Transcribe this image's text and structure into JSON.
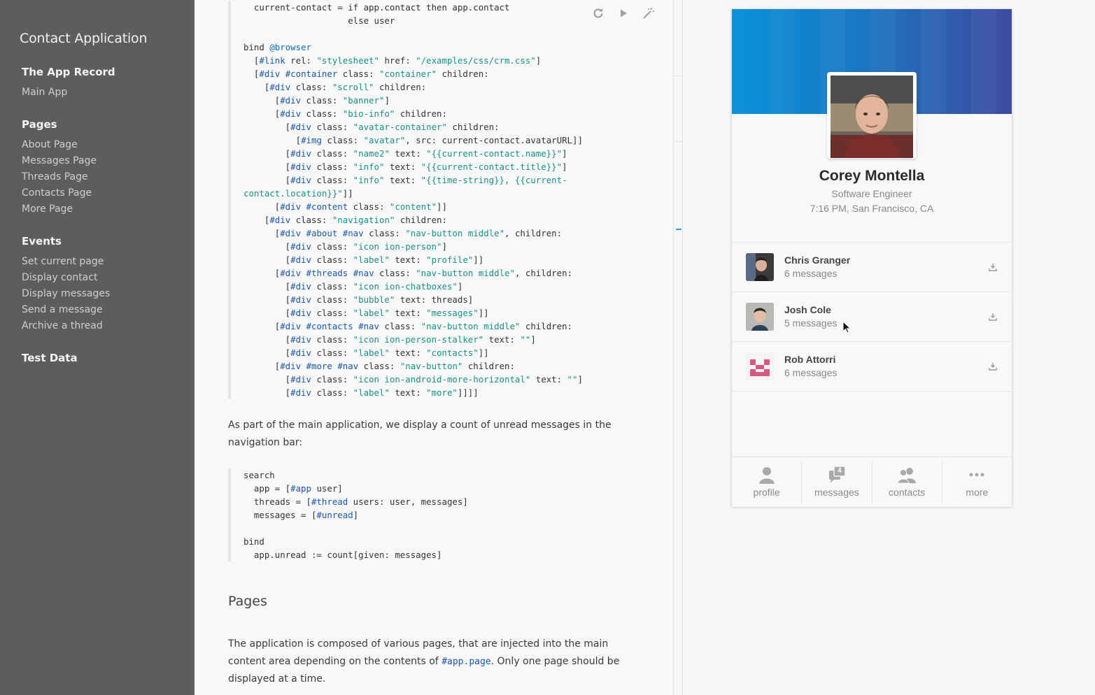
{
  "sidebar": {
    "app_title": "Contact Application",
    "sections": [
      {
        "title": "The App Record",
        "items": [
          "Main App"
        ]
      },
      {
        "title": "Pages",
        "items": [
          "About Page",
          "Messages Page",
          "Threads Page",
          "Contacts Page",
          "More Page"
        ]
      },
      {
        "title": "Events",
        "items": [
          "Set current page",
          "Display contact",
          "Display messages",
          "Send a message",
          "Archive a thread"
        ]
      },
      {
        "title": "Test Data",
        "items": []
      }
    ]
  },
  "doc": {
    "toolbar": {
      "reload_icon": "reload-icon",
      "run_icon": "play-icon",
      "format_icon": "magic-wand-icon"
    },
    "code1": [
      [
        [
          "plain",
          "  current-contact = "
        ],
        [
          "plain",
          "if"
        ],
        [
          "plain",
          " app.contact "
        ],
        [
          "plain",
          "then"
        ],
        [
          "plain",
          " app.contact"
        ]
      ],
      [
        [
          "plain",
          "                    else user"
        ]
      ],
      [
        [
          "plain",
          ""
        ]
      ],
      [
        [
          "plain",
          "bind "
        ],
        [
          "kw",
          "@browser"
        ]
      ],
      [
        [
          "plain",
          "  ["
        ],
        [
          "tag",
          "#link"
        ],
        [
          "plain",
          " rel: "
        ],
        [
          "str",
          "\"stylesheet\""
        ],
        [
          "plain",
          " href: "
        ],
        [
          "str",
          "\"/examples/css/crm.css\""
        ],
        [
          "plain",
          "]"
        ]
      ],
      [
        [
          "plain",
          "  ["
        ],
        [
          "tag",
          "#div"
        ],
        [
          "plain",
          " "
        ],
        [
          "tag",
          "#container"
        ],
        [
          "plain",
          " class: "
        ],
        [
          "str",
          "\"container\""
        ],
        [
          "plain",
          " children:"
        ]
      ],
      [
        [
          "plain",
          "    ["
        ],
        [
          "tag",
          "#div"
        ],
        [
          "plain",
          " class: "
        ],
        [
          "str",
          "\"scroll\""
        ],
        [
          "plain",
          " children:"
        ]
      ],
      [
        [
          "plain",
          "      ["
        ],
        [
          "tag",
          "#div"
        ],
        [
          "plain",
          " class: "
        ],
        [
          "str",
          "\"banner\""
        ],
        [
          "plain",
          "]"
        ]
      ],
      [
        [
          "plain",
          "      ["
        ],
        [
          "tag",
          "#div"
        ],
        [
          "plain",
          " class: "
        ],
        [
          "str",
          "\"bio-info\""
        ],
        [
          "plain",
          " children:"
        ]
      ],
      [
        [
          "plain",
          "        ["
        ],
        [
          "tag",
          "#div"
        ],
        [
          "plain",
          " class: "
        ],
        [
          "str",
          "\"avatar-container\""
        ],
        [
          "plain",
          " children:"
        ]
      ],
      [
        [
          "plain",
          "          ["
        ],
        [
          "tag",
          "#img"
        ],
        [
          "plain",
          " class: "
        ],
        [
          "str",
          "\"avatar\""
        ],
        [
          "plain",
          ", src: current-contact.avatarURL]]"
        ]
      ],
      [
        [
          "plain",
          "        ["
        ],
        [
          "tag",
          "#div"
        ],
        [
          "plain",
          " class: "
        ],
        [
          "str",
          "\"name2\""
        ],
        [
          "plain",
          " text: "
        ],
        [
          "str",
          "\"{{current-contact.name}}\""
        ],
        [
          "plain",
          "]"
        ]
      ],
      [
        [
          "plain",
          "        ["
        ],
        [
          "tag",
          "#div"
        ],
        [
          "plain",
          " class: "
        ],
        [
          "str",
          "\"info\""
        ],
        [
          "plain",
          " text: "
        ],
        [
          "str",
          "\"{{current-contact.title}}\""
        ],
        [
          "plain",
          "]"
        ]
      ],
      [
        [
          "plain",
          "        ["
        ],
        [
          "tag",
          "#div"
        ],
        [
          "plain",
          " class: "
        ],
        [
          "str",
          "\"info\""
        ],
        [
          "plain",
          " text: "
        ],
        [
          "str",
          "\"{{time-string}}, {{current-"
        ]
      ],
      [
        [
          "str",
          "contact.location}}\""
        ],
        [
          "plain",
          "]]"
        ]
      ],
      [
        [
          "plain",
          "      ["
        ],
        [
          "tag",
          "#div"
        ],
        [
          "plain",
          " "
        ],
        [
          "tag",
          "#content"
        ],
        [
          "plain",
          " class: "
        ],
        [
          "str",
          "\"content\""
        ],
        [
          "plain",
          "]]"
        ]
      ],
      [
        [
          "plain",
          "    ["
        ],
        [
          "tag",
          "#div"
        ],
        [
          "plain",
          " class: "
        ],
        [
          "str",
          "\"navigation\""
        ],
        [
          "plain",
          " children:"
        ]
      ],
      [
        [
          "plain",
          "      ["
        ],
        [
          "tag",
          "#div"
        ],
        [
          "plain",
          " "
        ],
        [
          "tag",
          "#about"
        ],
        [
          "plain",
          " "
        ],
        [
          "tag",
          "#nav"
        ],
        [
          "plain",
          " class: "
        ],
        [
          "str",
          "\"nav-button middle\""
        ],
        [
          "plain",
          ", children:"
        ]
      ],
      [
        [
          "plain",
          "        ["
        ],
        [
          "tag",
          "#div"
        ],
        [
          "plain",
          " class: "
        ],
        [
          "str",
          "\"icon ion-person\""
        ],
        [
          "plain",
          "]"
        ]
      ],
      [
        [
          "plain",
          "        ["
        ],
        [
          "tag",
          "#div"
        ],
        [
          "plain",
          " class: "
        ],
        [
          "str",
          "\"label\""
        ],
        [
          "plain",
          " text: "
        ],
        [
          "str",
          "\"profile\""
        ],
        [
          "plain",
          "]]"
        ]
      ],
      [
        [
          "plain",
          "      ["
        ],
        [
          "tag",
          "#div"
        ],
        [
          "plain",
          " "
        ],
        [
          "tag",
          "#threads"
        ],
        [
          "plain",
          " "
        ],
        [
          "tag",
          "#nav"
        ],
        [
          "plain",
          " class: "
        ],
        [
          "str",
          "\"nav-button middle\""
        ],
        [
          "plain",
          ", children:"
        ]
      ],
      [
        [
          "plain",
          "        ["
        ],
        [
          "tag",
          "#div"
        ],
        [
          "plain",
          " class: "
        ],
        [
          "str",
          "\"icon ion-chatboxes\""
        ],
        [
          "plain",
          "]"
        ]
      ],
      [
        [
          "plain",
          "        ["
        ],
        [
          "tag",
          "#div"
        ],
        [
          "plain",
          " class: "
        ],
        [
          "str",
          "\"bubble\""
        ],
        [
          "plain",
          " text: threads]"
        ]
      ],
      [
        [
          "plain",
          "        ["
        ],
        [
          "tag",
          "#div"
        ],
        [
          "plain",
          " class: "
        ],
        [
          "str",
          "\"label\""
        ],
        [
          "plain",
          " text: "
        ],
        [
          "str",
          "\"messages\""
        ],
        [
          "plain",
          "]]"
        ]
      ],
      [
        [
          "plain",
          "      ["
        ],
        [
          "tag",
          "#div"
        ],
        [
          "plain",
          " "
        ],
        [
          "tag",
          "#contacts"
        ],
        [
          "plain",
          " "
        ],
        [
          "tag",
          "#nav"
        ],
        [
          "plain",
          " class: "
        ],
        [
          "str",
          "\"nav-button middle\""
        ],
        [
          "plain",
          " children:"
        ]
      ],
      [
        [
          "plain",
          "        ["
        ],
        [
          "tag",
          "#div"
        ],
        [
          "plain",
          " class: "
        ],
        [
          "str",
          "\"icon ion-person-stalker\""
        ],
        [
          "plain",
          " text: "
        ],
        [
          "str",
          "\"\""
        ],
        [
          "plain",
          "]"
        ]
      ],
      [
        [
          "plain",
          "        ["
        ],
        [
          "tag",
          "#div"
        ],
        [
          "plain",
          " class: "
        ],
        [
          "str",
          "\"label\""
        ],
        [
          "plain",
          " text: "
        ],
        [
          "str",
          "\"contacts\""
        ],
        [
          "plain",
          "]]"
        ]
      ],
      [
        [
          "plain",
          "      ["
        ],
        [
          "tag",
          "#div"
        ],
        [
          "plain",
          " "
        ],
        [
          "tag",
          "#more"
        ],
        [
          "plain",
          " "
        ],
        [
          "tag",
          "#nav"
        ],
        [
          "plain",
          " class: "
        ],
        [
          "str",
          "\"nav-button\""
        ],
        [
          "plain",
          " children:"
        ]
      ],
      [
        [
          "plain",
          "        ["
        ],
        [
          "tag",
          "#div"
        ],
        [
          "plain",
          " class: "
        ],
        [
          "str",
          "\"icon ion-android-more-horizontal\""
        ],
        [
          "plain",
          " text: "
        ],
        [
          "str",
          "\"\""
        ],
        [
          "plain",
          "]"
        ]
      ],
      [
        [
          "plain",
          "        ["
        ],
        [
          "tag",
          "#div"
        ],
        [
          "plain",
          " class: "
        ],
        [
          "str",
          "\"label\""
        ],
        [
          "plain",
          " text: "
        ],
        [
          "str",
          "\"more\""
        ],
        [
          "plain",
          "]]]]"
        ]
      ]
    ],
    "para1": "As part of the main application, we display a count of unread messages in the navigation bar:",
    "code2": [
      [
        [
          "plain",
          "search"
        ]
      ],
      [
        [
          "plain",
          "  app = ["
        ],
        [
          "tag",
          "#app"
        ],
        [
          "plain",
          " user]"
        ]
      ],
      [
        [
          "plain",
          "  threads = ["
        ],
        [
          "tag",
          "#thread"
        ],
        [
          "plain",
          " users: user, messages]"
        ]
      ],
      [
        [
          "plain",
          "  messages = ["
        ],
        [
          "tag",
          "#unread"
        ],
        [
          "plain",
          "]"
        ]
      ],
      [
        [
          "plain",
          ""
        ]
      ],
      [
        [
          "plain",
          "bind"
        ]
      ],
      [
        [
          "plain",
          "  app.unread := count[given: messages]"
        ]
      ]
    ],
    "heading_pages": "Pages",
    "para2_before": "The application is composed of various pages, that are injected into the main content area depending on the contents of ",
    "para2_code": "#app.page",
    "para2_after": ". Only one page should be displayed at a time."
  },
  "preview": {
    "profile": {
      "name": "Corey Montella",
      "title": "Software Engineer",
      "time_location": "7:16 PM, San Francisco, CA"
    },
    "contacts": [
      {
        "name": "Chris Granger",
        "count": "6 messages"
      },
      {
        "name": "Josh Cole",
        "count": "5 messages"
      },
      {
        "name": "Rob Attorri",
        "count": "6 messages"
      }
    ],
    "nav": [
      {
        "label": "profile",
        "icon": "person-icon"
      },
      {
        "label": "messages",
        "icon": "chatboxes-icon",
        "badge": "4"
      },
      {
        "label": "contacts",
        "icon": "person-stalker-icon"
      },
      {
        "label": "more",
        "icon": "more-horizontal-icon"
      }
    ],
    "colors": {
      "banner_start": "#0b93d9",
      "banner_end": "#3f4aa0",
      "accent": "#1a56b0",
      "string": "#16908a"
    }
  }
}
